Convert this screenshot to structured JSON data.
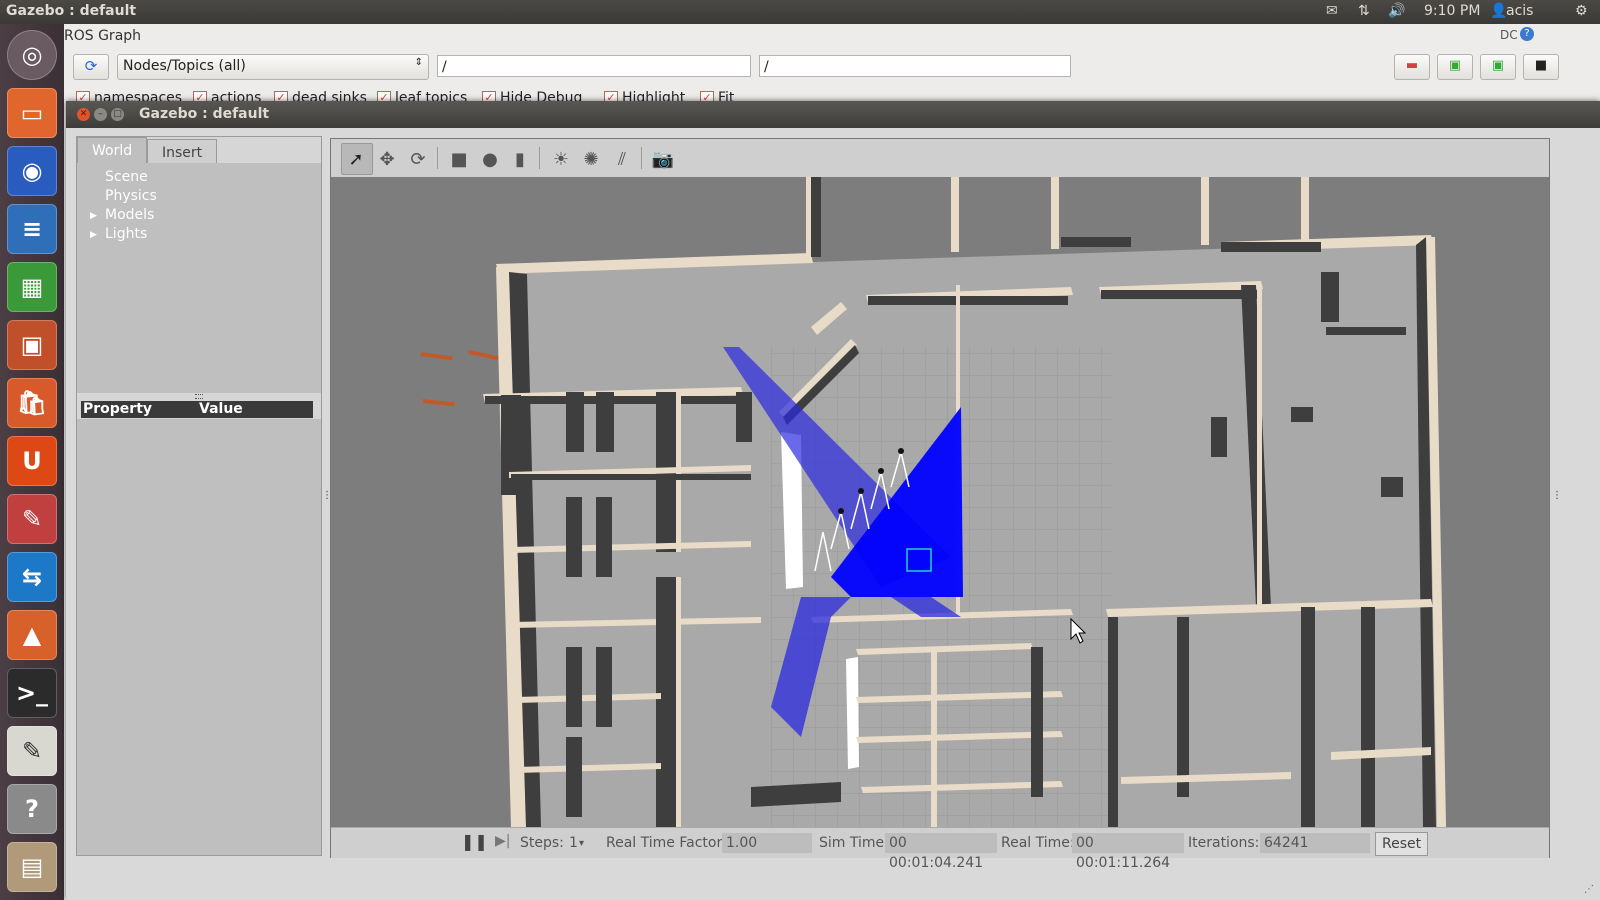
{
  "topbar": {
    "title": "Gazebo : default",
    "time": "9:10 PM",
    "user": "acis"
  },
  "launcher": {
    "items": [
      "dash",
      "files",
      "firefox",
      "writer",
      "calc",
      "impress",
      "software-center",
      "ubuntu-one",
      "system-settings",
      "teamviewer",
      "matlab",
      "terminal",
      "text-editor",
      "help",
      "workspaces"
    ]
  },
  "ros": {
    "title": "ROS Graph",
    "graph_mode": "Nodes/Topics (all)",
    "filter1": "/",
    "filter2": "/",
    "checkboxes": [
      {
        "label": "namespaces",
        "checked": true
      },
      {
        "label": "actions",
        "checked": true
      },
      {
        "label": "dead sinks",
        "checked": true
      },
      {
        "label": "leaf topics",
        "checked": true
      },
      {
        "label": "Hide Debug",
        "checked": true
      },
      {
        "label": "Highlight",
        "checked": true
      },
      {
        "label": "Fit",
        "checked": true
      }
    ],
    "top_right_icons": "DC"
  },
  "gazebo": {
    "title": "Gazebo : default",
    "tabs": {
      "world": "World",
      "insert": "Insert"
    },
    "tree": {
      "scene": "Scene",
      "physics": "Physics",
      "models": "Models",
      "lights": "Lights"
    },
    "props": {
      "property": "Property",
      "value": "Value"
    },
    "status": {
      "steps_label": "Steps:",
      "steps_value": "1",
      "rtf_label": "Real Time Factor:",
      "rtf_value": "1.00",
      "sim_time_label": "Sim Time:",
      "sim_time_value": "00 00:01:04.241",
      "real_time_label": "Real Time:",
      "real_time_value": "00 00:01:11.264",
      "iterations_label": "Iterations:",
      "iterations_value": "64241",
      "reset_label": "Reset"
    }
  },
  "colors": {
    "laser": "#0000ff",
    "wall_top": "#e8dcc8",
    "wall_side": "#3d3d3d",
    "floor": "#a8a8a8"
  }
}
